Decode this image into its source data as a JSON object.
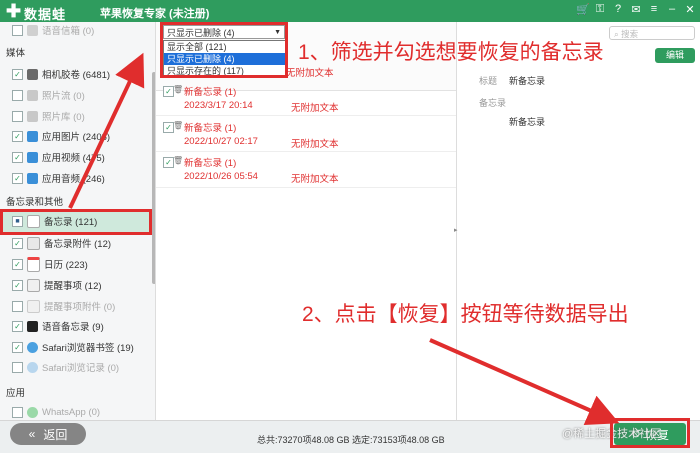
{
  "titlebar": {
    "brand": "数据蛙",
    "app_title": "苹果恢复专家 (未注册)",
    "icons": [
      "cart-icon",
      "key-icon",
      "help-icon",
      "chat-icon",
      "menu-icon",
      "minimize-icon",
      "close-icon"
    ]
  },
  "sidebar": {
    "items": [
      {
        "label": "语音信箱 (0)",
        "checked": false,
        "dim": true
      },
      {
        "label": "相机胶卷 (6481)",
        "checked": true,
        "dim": false
      },
      {
        "label": "照片流 (0)",
        "checked": false,
        "dim": true
      },
      {
        "label": "照片库 (0)",
        "checked": false,
        "dim": true
      },
      {
        "label": "应用图片 (2408)",
        "checked": true,
        "dim": false
      },
      {
        "label": "应用视频 (475)",
        "checked": true,
        "dim": false
      },
      {
        "label": "应用音频 (246)",
        "checked": true,
        "dim": false
      },
      {
        "label": "备忘录 (121)",
        "checked": "partial",
        "dim": false
      },
      {
        "label": "备忘录附件 (12)",
        "checked": true,
        "dim": false
      },
      {
        "label": "日历 (223)",
        "checked": true,
        "dim": false
      },
      {
        "label": "提醒事项 (12)",
        "checked": true,
        "dim": false
      },
      {
        "label": "提醒事项附件 (0)",
        "checked": false,
        "dim": true
      },
      {
        "label": "语音备忘录 (9)",
        "checked": true,
        "dim": false
      },
      {
        "label": "Safari浏览器书签 (19)",
        "checked": true,
        "dim": false
      },
      {
        "label": "Safari浏览记录 (0)",
        "checked": false,
        "dim": true
      },
      {
        "label": "WhatsApp (0)",
        "checked": false,
        "dim": true
      }
    ],
    "sections": {
      "media": "媒体",
      "notes_other": "备忘录和其他",
      "apps": "应用"
    }
  },
  "filter": {
    "selected": "只显示已删除 (4)",
    "options": [
      "显示全部 (121)",
      "只显示已删除 (4)",
      "只显示存在的 (117)"
    ],
    "behind_text": "无附加文本"
  },
  "records": [
    {
      "title": "新备忘录 (1)",
      "date": "2023/3/17 20:14",
      "extra": "无附加文本"
    },
    {
      "title": "新备忘录 (1)",
      "date": "2022/10/27 02:17",
      "extra": "无附加文本"
    },
    {
      "title": "新备忘录 (1)",
      "date": "2022/10/26 05:54",
      "extra": "无附加文本"
    }
  ],
  "detail": {
    "search_placeholder": "搜索",
    "edit_label": "编辑",
    "title_label": "标题",
    "title_value": "新备忘录",
    "note_label": "备忘录",
    "note_value": "新备忘录"
  },
  "footer": {
    "back_label": "返回",
    "status": "总共:73270项48.08 GB 选定:73153项48.08 GB",
    "recover_label": "恢复",
    "watermark": "@稀土掘金技术社区"
  },
  "annotations": {
    "step1": "1、筛选并勾选想要恢复的备忘录",
    "step2": "2、点击【恢复】按钮等待数据导出"
  },
  "colors": {
    "brand_green": "#2f9c5e",
    "annotation_red": "#e02d2d",
    "deleted_red": "#e03030",
    "selected_blue": "#1e6fd9"
  }
}
